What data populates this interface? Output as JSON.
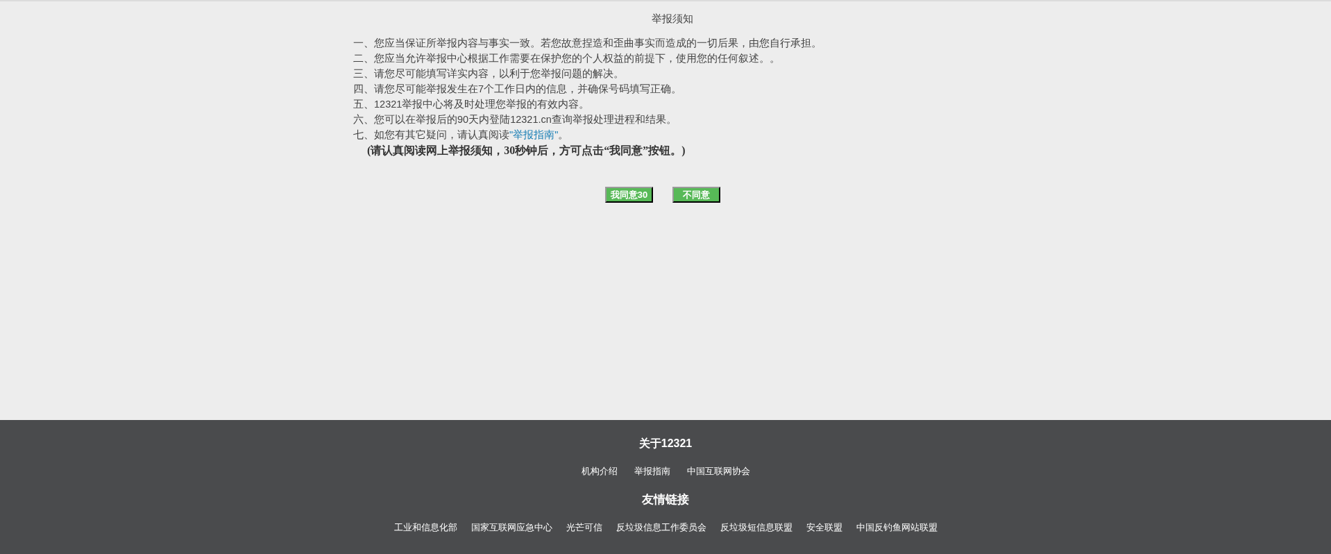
{
  "notice": {
    "title": "举报须知",
    "items": [
      {
        "text": "一、您应当保证所举报内容与事实一致。若您故意捏造和歪曲事实而造成的一切后果，由您自行承担。"
      },
      {
        "text": "二、您应当允许举报中心根据工作需要在保护您的个人权益的前提下，使用您的任何叙述。。"
      },
      {
        "text": "三、请您尽可能填写详实内容，以利于您举报问题的解决。"
      },
      {
        "text": "四、请您尽可能举报发生在7个工作日内的信息，并确保号码填写正确。"
      },
      {
        "text": "五、12321举报中心将及时处理您举报的有效内容。"
      },
      {
        "text": "六、您可以在举报后的90天内登陆12321.cn查询举报处理进程和结果。"
      },
      {
        "text": "七、如您有其它疑问，请认真阅读",
        "link": "\"举报指南\"",
        "suffix": "。"
      }
    ],
    "reminder": "(请认真阅读网上举报须知，30秒钟后，方可点击“我同意”按钮。)"
  },
  "buttons": [
    "我同意30",
    "不同意"
  ],
  "footer": {
    "about_title": "关于12321",
    "about_links": [
      "机构介绍",
      "举报指南",
      "中国互联网协会"
    ],
    "friends_title": "友情链接",
    "friend_links": [
      "工业和信息化部",
      "国家互联网应急中心",
      "光芒可信",
      "反垃圾信息工作委员会",
      "反垃圾短信息联盟",
      "安全联盟",
      "中国反钓鱼网站联盟"
    ]
  }
}
